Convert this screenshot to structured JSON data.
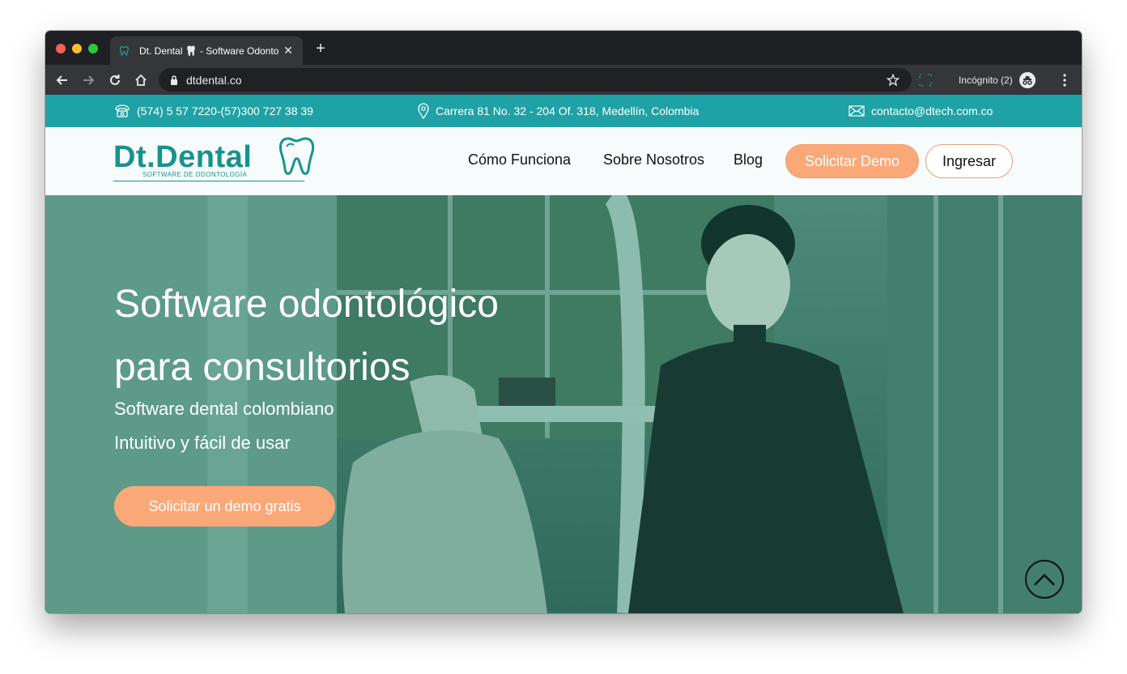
{
  "browser": {
    "tab_title": "Dt. Dental 🦷 - Software Odontológico",
    "new_tab_symbol": "+",
    "close_symbol": "✕",
    "url": "dtdental.co",
    "incognito_label": "Incógnito (2)",
    "icons": [
      "back-icon",
      "forward-icon",
      "reload-icon",
      "home-icon",
      "lock-icon",
      "star-icon",
      "extension-icon",
      "incognito-icon",
      "menu-icon"
    ]
  },
  "contact_bar": {
    "phone": "(574) 5 57 7220-(57)300 727 38 39",
    "address": "Carrera 81 No. 32 - 204 Of. 318, Medellín, Colombia",
    "email": "contacto@dtech.com.co",
    "color": "#1fa2a6"
  },
  "header": {
    "logo_text": "Dt.Dental",
    "logo_subtitle": "SOFTWARE DE ODONTOLOGÍA",
    "nav": [
      {
        "label": "Cómo Funciona"
      },
      {
        "label": "Sobre Nosotros"
      },
      {
        "label": "Blog"
      }
    ],
    "demo_button": "Solicitar Demo",
    "login_button": "Ingresar",
    "accent_color": "#fba879",
    "brand_color": "#14948f"
  },
  "hero": {
    "title_line1": "Software odontológico",
    "title_line2": "para consultorios",
    "subtitle_line1": "Software dental colombiano",
    "subtitle_line2": "Intuitivo y fácil de usar",
    "cta": "Solicitar un demo gratis"
  }
}
